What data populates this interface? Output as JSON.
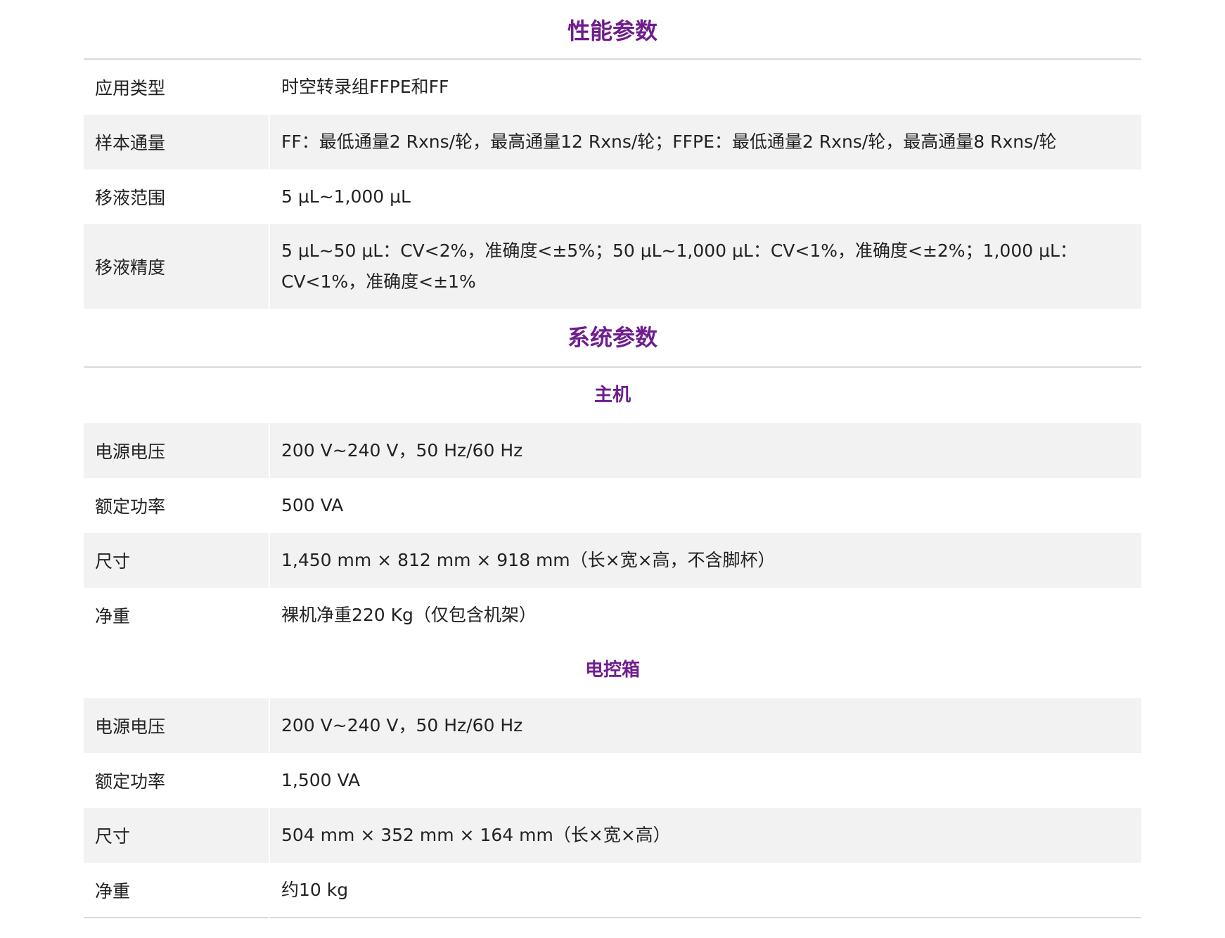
{
  "performance": {
    "title": "性能参数",
    "rows": [
      {
        "label": "应用类型",
        "value": "时空转录组FFPE和FF"
      },
      {
        "label": "样本通量",
        "value": "FF：最低通量2 Rxns/轮，最高通量12 Rxns/轮；FFPE：最低通量2 Rxns/轮，最高通量8 Rxns/轮"
      },
      {
        "label": "移液范围",
        "value": "5 μL~1,000 μL"
      },
      {
        "label": "移液精度",
        "value": "5 μL~50 μL：CV<2%，准确度<±5%；50 μL~1,000 μL：CV<1%，准确度<±2%；1,000 μL：CV<1%，准确度<±1%"
      }
    ]
  },
  "system": {
    "title": "系统参数",
    "host": {
      "title": "主机",
      "rows": [
        {
          "label": "电源电压",
          "value": "200 V~240 V，50 Hz/60 Hz"
        },
        {
          "label": "额定功率",
          "value": "500 VA"
        },
        {
          "label": "尺寸",
          "value": "1,450 mm × 812 mm × 918 mm（长×宽×高，不含脚杯）"
        },
        {
          "label": "净重",
          "value": "裸机净重220 Kg（仅包含机架）"
        }
      ]
    },
    "control_box": {
      "title": "电控箱",
      "rows": [
        {
          "label": "电源电压",
          "value": "200 V~240 V，50 Hz/60 Hz"
        },
        {
          "label": "额定功率",
          "value": "1,500 VA"
        },
        {
          "label": "尺寸",
          "value": "504 mm × 352 mm × 164 mm（长×宽×高）"
        },
        {
          "label": "净重",
          "value": "约10 kg"
        }
      ]
    }
  },
  "colors": {
    "accent": "#6f1d8f",
    "row_stripe": "#f2f2f2",
    "rule": "#d9d9d9"
  }
}
